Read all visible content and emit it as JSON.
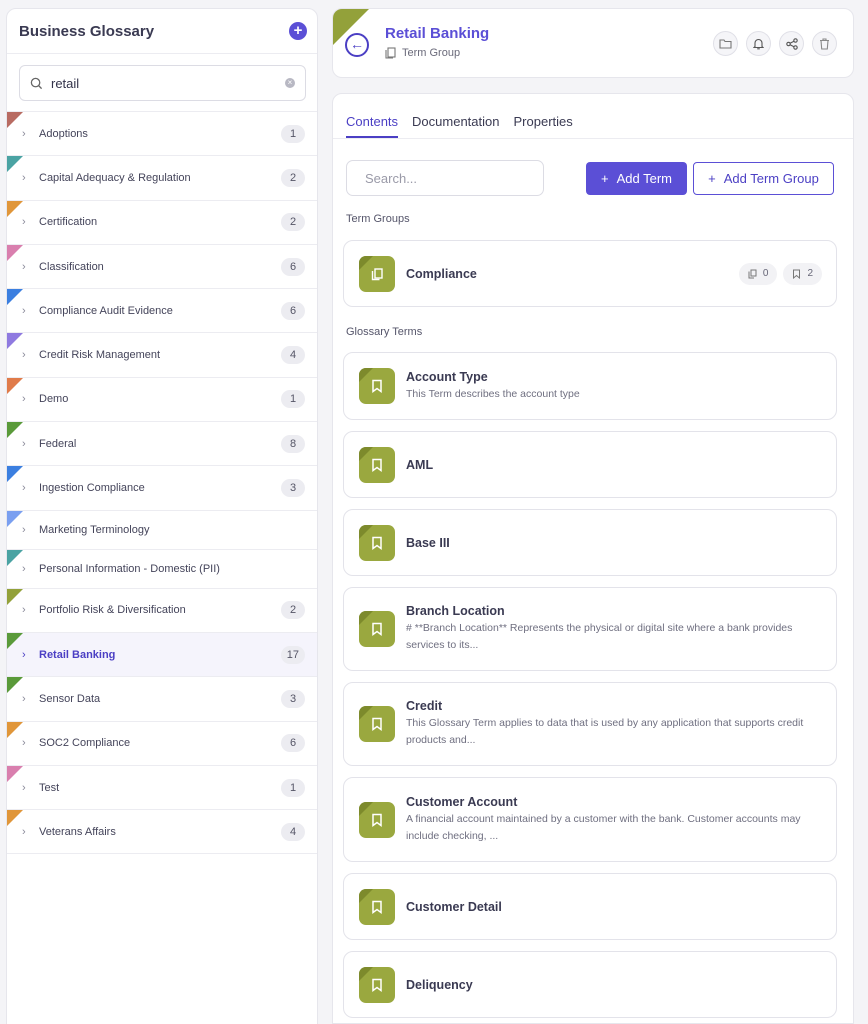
{
  "sidebar": {
    "title": "Business Glossary",
    "search_value": "retail",
    "items": [
      {
        "label": "Adoptions",
        "count": "1",
        "color": "#b86b62"
      },
      {
        "label": "Capital Adequacy & Regulation",
        "count": "2",
        "color": "#4aa3a3"
      },
      {
        "label": "Certification",
        "count": "2",
        "color": "#e0963a"
      },
      {
        "label": "Classification",
        "count": "6",
        "color": "#d97fae"
      },
      {
        "label": "Compliance Audit Evidence",
        "count": "6",
        "color": "#3b7fe0"
      },
      {
        "label": "Credit Risk Management",
        "count": "4",
        "color": "#8f7ae0"
      },
      {
        "label": "Demo",
        "count": "1",
        "color": "#e07b4a"
      },
      {
        "label": "Federal",
        "count": "8",
        "color": "#5a9a3a"
      },
      {
        "label": "Ingestion Compliance",
        "count": "3",
        "color": "#3b7fe0"
      },
      {
        "label": "Marketing Terminology",
        "count": "",
        "color": "#7a9ff0"
      },
      {
        "label": "Personal Information - Domestic (PII)",
        "count": "",
        "color": "#4aa3a3"
      },
      {
        "label": "Portfolio Risk & Diversification",
        "count": "2",
        "color": "#93a13a"
      },
      {
        "label": "Retail Banking",
        "count": "17",
        "color": "#5a9a3a"
      },
      {
        "label": "Sensor Data",
        "count": "3",
        "color": "#5a9a3a"
      },
      {
        "label": "SOC2 Compliance",
        "count": "6",
        "color": "#e0963a"
      },
      {
        "label": "Test",
        "count": "1",
        "color": "#d97fae"
      },
      {
        "label": "Veterans Affairs",
        "count": "4",
        "color": "#e0963a"
      }
    ]
  },
  "header": {
    "title": "Retail Banking",
    "subtitle": "Term Group",
    "accent": "#93a13a"
  },
  "tabs": [
    "Contents",
    "Documentation",
    "Properties"
  ],
  "toolbar": {
    "search_placeholder": "Search...",
    "add_term": "Add Term",
    "add_term_group": "Add Term Group"
  },
  "sections": {
    "term_groups": "Term Groups",
    "glossary_terms": "Glossary Terms"
  },
  "term_groups": [
    {
      "name": "Compliance",
      "groups_count": "0",
      "terms_count": "2"
    }
  ],
  "terms": [
    {
      "name": "Account Type",
      "desc": "This Term describes the account type"
    },
    {
      "name": "AML",
      "desc": ""
    },
    {
      "name": "Base III",
      "desc": ""
    },
    {
      "name": "Branch Location",
      "desc": "# **Branch Location** Represents the physical or digital site where a bank provides services to its..."
    },
    {
      "name": "Credit",
      "desc": "This Glossary Term applies to data that is used by any application that supports credit products and..."
    },
    {
      "name": "Customer Account",
      "desc": "A financial account maintained by a customer with the bank. Customer accounts may include checking, ..."
    },
    {
      "name": "Customer Detail",
      "desc": ""
    },
    {
      "name": "Deliquency",
      "desc": ""
    }
  ]
}
